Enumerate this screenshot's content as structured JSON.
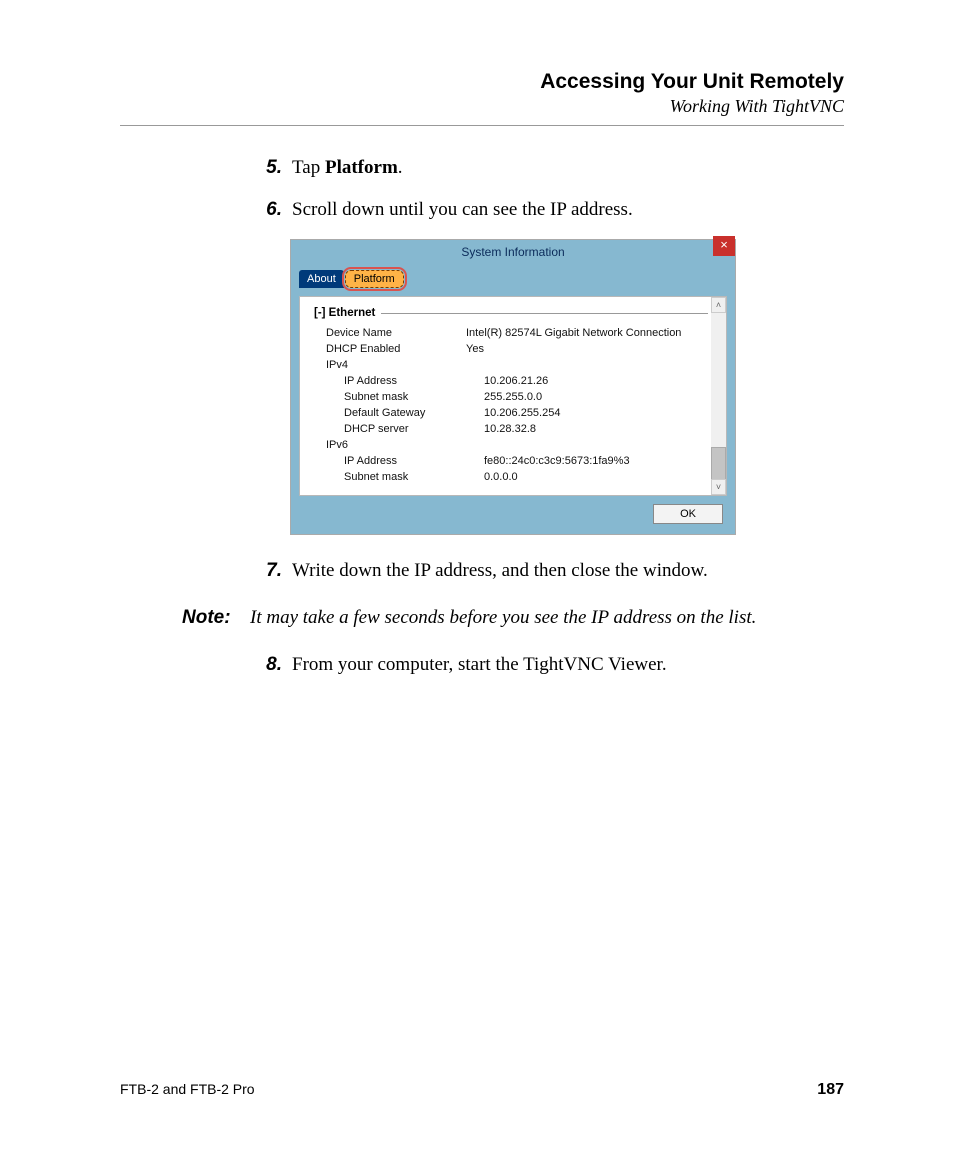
{
  "header": {
    "title": "Accessing Your Unit Remotely",
    "subtitle": "Working With TightVNC"
  },
  "steps": {
    "s5": {
      "num": "5.",
      "pre": "Tap ",
      "bold": "Platform",
      "post": "."
    },
    "s6": {
      "num": "6.",
      "text": "Scroll down until you can see the IP address."
    },
    "s7": {
      "num": "7.",
      "text": "Write down the IP address, and then close the window."
    },
    "s8": {
      "num": "8.",
      "text": "From your computer, start the TightVNC Viewer."
    }
  },
  "note": {
    "label": "Note:",
    "text": "It may take a few seconds before you see the IP address on the list."
  },
  "dialog": {
    "title": "System Information",
    "close_glyph": "×",
    "tabs": {
      "about": "About",
      "platform": "Platform"
    },
    "group_header": "[-] Ethernet",
    "rows": {
      "device_name_k": "Device Name",
      "device_name_v": "Intel(R) 82574L Gigabit Network Connection",
      "dhcp_enabled_k": "DHCP Enabled",
      "dhcp_enabled_v": "Yes",
      "ipv4_k": "IPv4",
      "ip4_addr_k": "IP Address",
      "ip4_addr_v": "10.206.21.26",
      "ip4_mask_k": "Subnet mask",
      "ip4_mask_v": "255.255.0.0",
      "gw_k": "Default Gateway",
      "gw_v": "10.206.255.254",
      "dhcp_srv_k": "DHCP server",
      "dhcp_srv_v": "10.28.32.8",
      "ipv6_k": "IPv6",
      "ip6_addr_k": "IP Address",
      "ip6_addr_v": "fe80::24c0:c3c9:5673:1fa9%3",
      "ip6_mask_k": "Subnet mask",
      "ip6_mask_v": "0.0.0.0"
    },
    "ok_label": "OK",
    "scroll": {
      "up": "˄",
      "down": "˅"
    }
  },
  "footer": {
    "product": "FTB-2 and FTB-2 Pro",
    "page": "187"
  }
}
